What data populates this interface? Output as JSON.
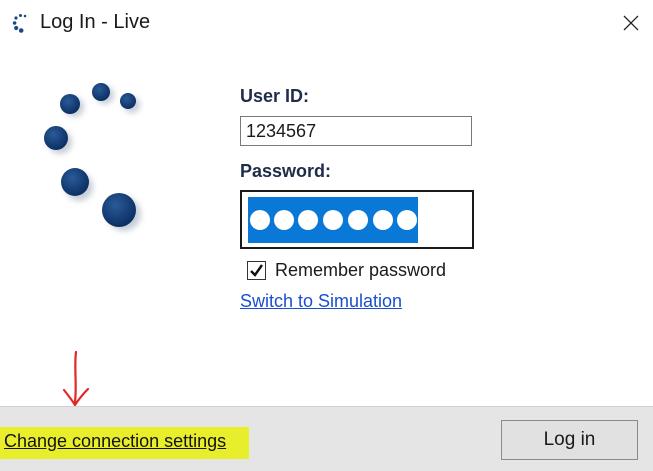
{
  "window": {
    "title": "Log In - Live",
    "app_icon": "spinner-dots-icon",
    "close_icon": "close-icon"
  },
  "form": {
    "userid_label": "User ID:",
    "userid_value": "1234567",
    "password_label": "Password:",
    "password_mask": "●●●●●●●",
    "remember_label": "Remember password",
    "remember_checked": true,
    "switch_link": "Switch to Simulation"
  },
  "footer": {
    "connection_link": "Change connection settings",
    "login_button": "Log in"
  },
  "colors": {
    "brand_blue": "#0d3a75",
    "selection_blue": "#0a78d7",
    "link_blue": "#1a4fd0",
    "highlight_yellow": "#e8ee2c",
    "annotation_red": "#e32727"
  }
}
